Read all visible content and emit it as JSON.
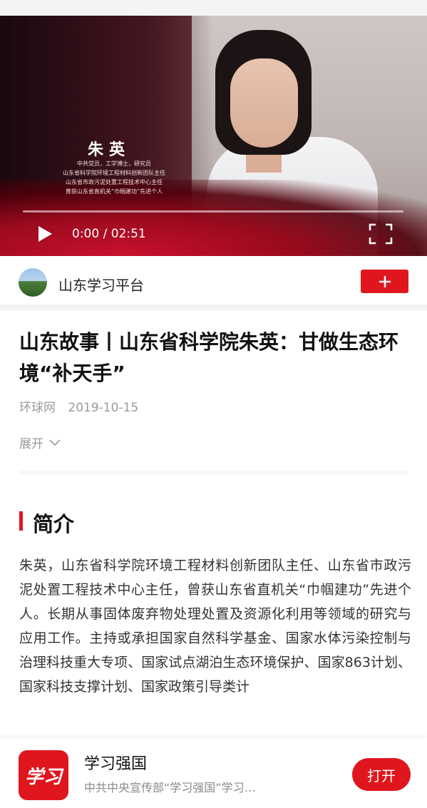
{
  "video": {
    "name": "朱英",
    "caption_lines": [
      "中共党员，工学博士，研究员",
      "山东省科学院环境工程材料创新团队主任",
      "山东省市政污泥处置工程技术中心主任",
      "曾获山东省直机关“巾帼建功”先进个人"
    ],
    "time": "0:00 / 02:51",
    "progress": 0,
    "icons": {
      "play": "play-icon",
      "fullscreen": "fullscreen-icon"
    }
  },
  "account": {
    "name": "山东学习平台",
    "follow_icon": "plus-icon",
    "accent": "#e0161e"
  },
  "article": {
    "title": "山东故事丨山东省科学院朱英：甘做生态环境“补天手”",
    "source": "环球网",
    "date": "2019-10-15",
    "expand_label": "展开",
    "section_title": "简介",
    "intro": "朱英，山东省科学院环境工程材料创新团队主任、山东省市政污泥处置工程技术中心主任，曾获山东省直机关“巾帼建功”先进个人。长期从事固体废弃物处理处置及资源化利用等领域的研究与应用工作。主持或承担国家自然科学基金、国家水体污染控制与治理科技重大专项、国家试点湖泊生态环境保护、国家863计划、国家科技支撑计划、国家政策引导类计"
  },
  "banner": {
    "app_icon_text": "学习",
    "app_name": "学习强国",
    "app_desc": "中共中央宣传部“学习强国”学习…",
    "open_label": "打开"
  }
}
